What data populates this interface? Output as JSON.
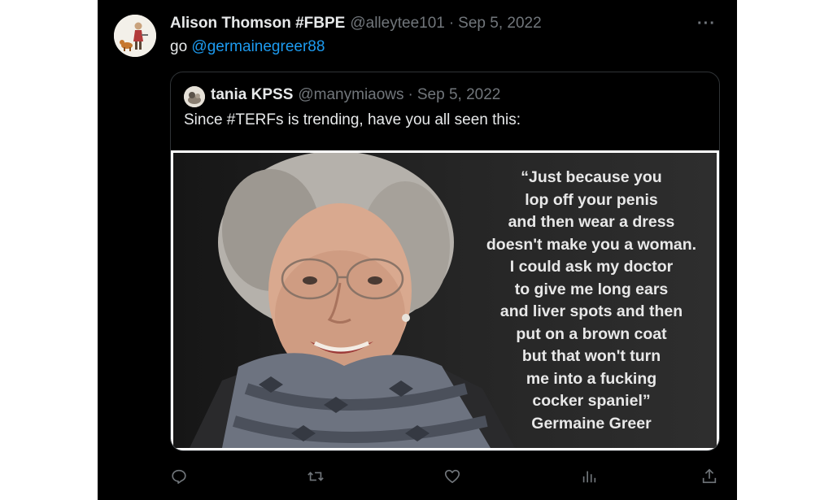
{
  "tweet": {
    "display_name": "Alison Thomson #FBPE",
    "handle": "@alleytee101",
    "separator": "·",
    "date": "Sep 5, 2022",
    "more_label": "···",
    "text_prefix": "go ",
    "mention": "@germainegreer88"
  },
  "quoted": {
    "display_name": "tania KPSS",
    "handle": "@manymiaows",
    "separator": "·",
    "date": "Sep 5, 2022",
    "text": "Since #TERFs is trending, have you all seen this:",
    "image_quote_lines": [
      "“Just because you",
      "lop off your penis",
      "and then wear a dress",
      "doesn't make you a woman.",
      "I could ask my doctor",
      "to give me long ears",
      "and liver spots and then",
      "put on a brown coat",
      "but that won't turn",
      "me into a fucking",
      "cocker spaniel”",
      "Germaine Greer"
    ]
  },
  "actions": [
    {
      "name": "reply",
      "icon": "reply-icon"
    },
    {
      "name": "retweet",
      "icon": "retweet-icon"
    },
    {
      "name": "like",
      "icon": "heart-icon"
    },
    {
      "name": "views",
      "icon": "views-icon"
    },
    {
      "name": "share",
      "icon": "share-icon"
    }
  ],
  "colors": {
    "background": "#000000",
    "text": "#e7e9ea",
    "muted": "#71767b",
    "link": "#1d9bf0",
    "border": "#2f3336"
  }
}
